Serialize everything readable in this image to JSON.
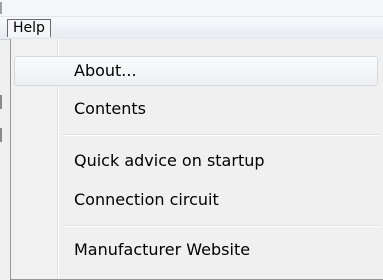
{
  "menubar": {
    "help_label": "Help"
  },
  "help_menu": {
    "items": [
      {
        "label": "About..."
      },
      {
        "label": "Contents"
      },
      {
        "label": "Quick advice on startup"
      },
      {
        "label": "Connection circuit"
      },
      {
        "label": "Manufacturer Website"
      }
    ]
  }
}
